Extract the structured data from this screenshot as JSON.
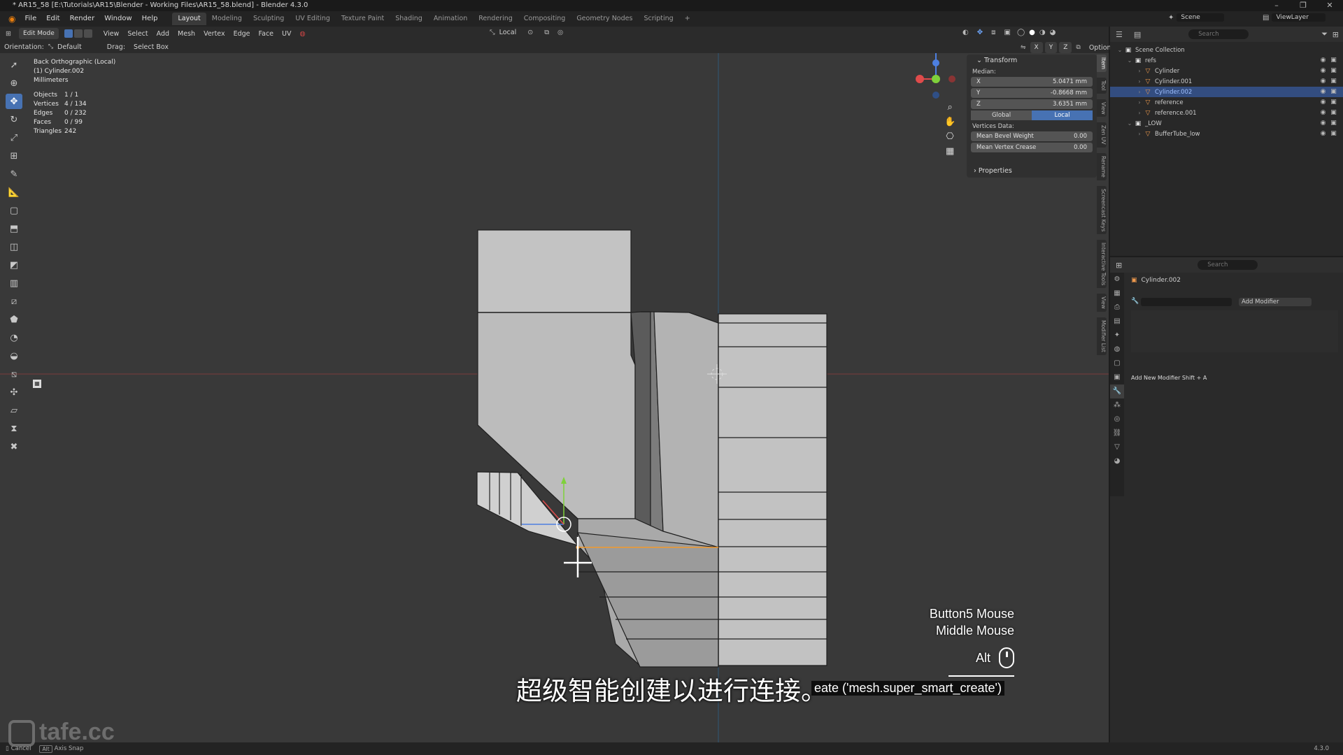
{
  "window": {
    "title": "* AR15_58 [E:\\Tutorials\\AR15\\Blender - Working Files\\AR15_58.blend] - Blender 4.3.0",
    "controls": [
      "–",
      "❐",
      "✕"
    ]
  },
  "menubar": {
    "items": [
      "File",
      "Edit",
      "Render",
      "Window",
      "Help"
    ],
    "workspaces": [
      "Layout",
      "Modeling",
      "Sculpting",
      "UV Editing",
      "Texture Paint",
      "Shading",
      "Animation",
      "Rendering",
      "Compositing",
      "Geometry Nodes",
      "Scripting"
    ],
    "active_workspace": "Layout",
    "add_tab": "+",
    "scene_label": "Scene",
    "viewlayer_label": "ViewLayer"
  },
  "header": {
    "mode": "Edit Mode",
    "menus": [
      "View",
      "Select",
      "Add",
      "Mesh",
      "Vertex",
      "Edge",
      "Face",
      "UV"
    ],
    "transform_orientation": "Local",
    "orientation_label": "Orientation:",
    "orientation_value": "Default",
    "drag_label": "Drag:",
    "drag_value": "Select Box",
    "options_label": "Options",
    "axis_buttons": [
      "X",
      "Y",
      "Z"
    ]
  },
  "viewport_info": {
    "view_name": "Back Orthographic (Local)",
    "object": "(1) Cylinder.002",
    "units": "Millimeters",
    "stats": [
      {
        "k": "Objects",
        "v": "1 / 1"
      },
      {
        "k": "Vertices",
        "v": "4 / 134"
      },
      {
        "k": "Edges",
        "v": "0 / 232"
      },
      {
        "k": "Faces",
        "v": "0 / 99"
      },
      {
        "k": "Triangles",
        "v": "242"
      }
    ]
  },
  "npanel": {
    "transform_title": "Transform",
    "median_label": "Median:",
    "x_label": "X",
    "x_value": "5.0471 mm",
    "y_label": "Y",
    "y_value": "-0.8668 mm",
    "z_label": "Z",
    "z_value": "3.6351 mm",
    "global_label": "Global",
    "local_label": "Local",
    "vertices_data_label": "Vertices Data:",
    "bevel_label": "Mean Bevel Weight",
    "bevel_value": "0.00",
    "crease_label": "Mean Vertex Crease",
    "crease_value": "0.00",
    "properties_title": "Properties",
    "tabs": [
      "Item",
      "Tool",
      "View",
      "Zen UV",
      "Rename",
      "Screencast Keys",
      "Interactive Tools",
      "View",
      "Modifier List"
    ]
  },
  "outliner": {
    "search_placeholder": "Search",
    "rows": [
      {
        "name": "Scene Collection",
        "indent": 0,
        "type": "collection"
      },
      {
        "name": "refs",
        "indent": 1,
        "type": "collection"
      },
      {
        "name": "Cylinder",
        "indent": 2,
        "type": "mesh"
      },
      {
        "name": "Cylinder.001",
        "indent": 2,
        "type": "mesh"
      },
      {
        "name": "Cylinder.002",
        "indent": 2,
        "type": "mesh",
        "selected": true
      },
      {
        "name": "reference",
        "indent": 2,
        "type": "image"
      },
      {
        "name": "reference.001",
        "indent": 2,
        "type": "image"
      },
      {
        "name": "_LOW",
        "indent": 1,
        "type": "collection"
      },
      {
        "name": "BufferTube_low",
        "indent": 2,
        "type": "mesh"
      }
    ]
  },
  "properties": {
    "search_placeholder": "Search",
    "object_name": "Cylinder.002",
    "add_modifier": "Add Modifier",
    "hint": "Add New Modifier Shift + A"
  },
  "screencast": {
    "lines": [
      "Button5 Mouse",
      "Middle Mouse"
    ],
    "modifier_key": "Alt",
    "operator": "eate ('mesh.super_smart_create')"
  },
  "subtitle": "超级智能创建以进行连接。",
  "statusbar": {
    "cancel_label": "Cancel",
    "alt_key": "Alt",
    "axis_snap_label": "Axis Snap",
    "version": "4.3.0"
  },
  "watermark": "tafe.cc",
  "colors": {
    "accent": "#4772b3",
    "viewport_bg": "#393939",
    "mesh_face": "#bdbdbd",
    "selected_edge": "#f39a2c"
  }
}
